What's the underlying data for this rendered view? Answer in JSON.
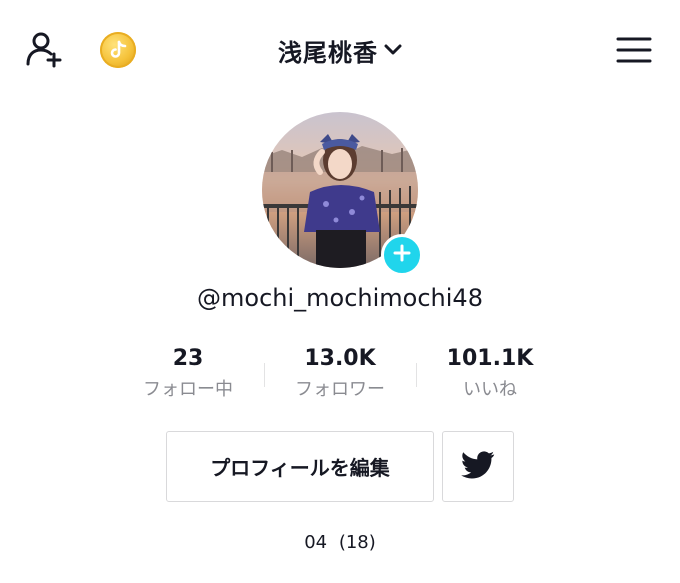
{
  "header": {
    "title": "浅尾桃香",
    "icons": {
      "left": "add-user-icon",
      "coin": "tiktok-coin-icon",
      "title_chevron": "chevron-down-icon",
      "right": "menu-icon"
    }
  },
  "profile": {
    "avatar": "profile-photo",
    "avatar_badge_icon": "plus-icon",
    "username": "@mochi_mochimochi48"
  },
  "stats": [
    {
      "value": "23",
      "label": "フォロー中"
    },
    {
      "value": "13.0K",
      "label": "フォロワー"
    },
    {
      "value": "101.1K",
      "label": "いいね"
    }
  ],
  "actions": {
    "edit_profile_label": "プロフィールを編集",
    "twitter_icon": "twitter-icon"
  },
  "bio": "04 (18)",
  "colors": {
    "text": "#161823",
    "muted": "#8a8b91",
    "accent": "#20d5ec",
    "coin": "#f5c23a"
  }
}
